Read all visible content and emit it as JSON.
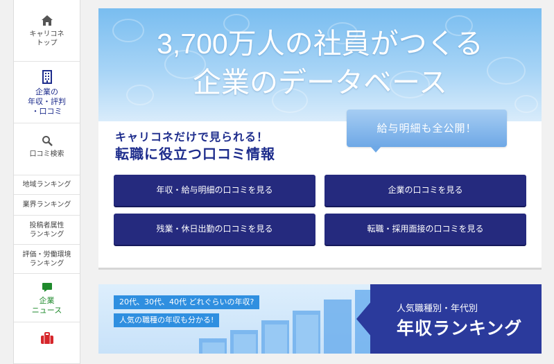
{
  "sidebar": {
    "top_label": "キャリコネ\nトップ",
    "company_label": "企業の\n年収・評判\n・口コミ",
    "search_label": "口コミ検索",
    "region_ranking": "地域ランキング",
    "industry_ranking": "業界ランキング",
    "poster_ranking": "投稿者属性\nランキング",
    "workenv_ranking": "評価・労働環境\nランキング",
    "news_label": "企業\nニュース",
    "colors": {
      "company": "#1d2c8c",
      "news": "#1f8a2c",
      "job": "#d6262b"
    },
    "icons": [
      "home-icon",
      "building-icon",
      "search-icon",
      "chat-icon",
      "briefcase-icon"
    ]
  },
  "hero": {
    "line1": "3,700万人の社員がつくる",
    "line2": "企業のデータベース",
    "tagline1": "キャリコネだけで見られる！",
    "tagline2": "転職に役立つ口コミ情報",
    "callout": "給与明細も全公開！",
    "buttons": {
      "salary": "年収・給与明細の口コミを見る",
      "company": "企業の口コミを見る",
      "overtime": "残業・休日出勤の口コミを見る",
      "interview": "転職・採用面接の口コミを見る"
    },
    "colors": {
      "button": "#252a7e",
      "banner_top": "#79bdf0"
    }
  },
  "ranking_banner": {
    "pill1": "20代、30代、40代 どれぐらいの年収?",
    "pill2": "人気の職種の年収も分かる!",
    "subtitle": "人気職種別・年代別",
    "title": "年収ランキング",
    "colors": {
      "panel": "#2b3a9c",
      "pill": "#2f8fe0"
    }
  }
}
